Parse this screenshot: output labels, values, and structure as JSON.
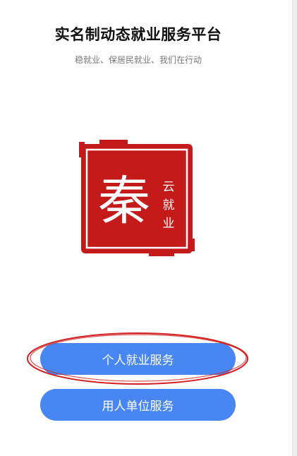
{
  "header": {
    "title": "实名制动态就业服务平台",
    "subtitle": "稳就业、保居民就业、我们在行动"
  },
  "logo": {
    "icon": "red-seal-icon",
    "main_glyph": "秦",
    "side_glyphs": "云就业"
  },
  "buttons": {
    "personal_label": "个人就业服务",
    "employer_label": "用人单位服务"
  },
  "colors": {
    "button_blue": "#4786f3",
    "seal_red": "#c41a1a",
    "annotation_red": "#d21f1f"
  }
}
